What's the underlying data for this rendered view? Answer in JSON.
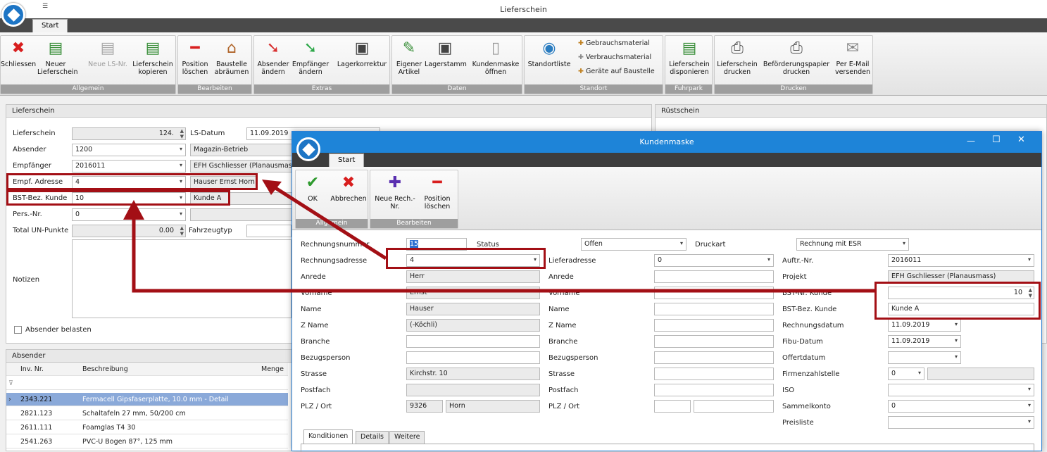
{
  "app": {
    "title": "Lieferschein",
    "qat": "☰",
    "tab": "Start"
  },
  "ribbon": {
    "groups": [
      "Allgemein",
      "Bearbeiten",
      "Extras",
      "Daten",
      "Standort",
      "Fuhrpark",
      "Drucken"
    ],
    "buttons": [
      {
        "l1": "Schliessen",
        "l2": "",
        "icon": "✖",
        "color": "#d81e1e"
      },
      {
        "l1": "Neuer",
        "l2": "Lieferschein",
        "icon": "☰",
        "color": "#3a8f3a"
      },
      {
        "l1": "Neue LS-Nr.",
        "l2": "",
        "icon": "☰",
        "color": "#aaaaaa"
      },
      {
        "l1": "Lieferschein",
        "l2": "kopieren",
        "icon": "☰",
        "color": "#3a8f3a"
      },
      {
        "l1": "Position",
        "l2": "löschen",
        "icon": "━",
        "color": "#d81e1e"
      },
      {
        "l1": "Baustelle",
        "l2": "abräumen",
        "icon": "⌂",
        "color": "#b0652a"
      },
      {
        "l1": "Absender",
        "l2": "ändern",
        "icon": "↘",
        "color": "#d83030"
      },
      {
        "l1": "Empfänger",
        "l2": "ändern",
        "icon": "↘",
        "color": "#2ea84a"
      },
      {
        "l1": "Lagerkorrektur",
        "l2": "",
        "icon": "▣",
        "color": "#444444"
      },
      {
        "l1": "Eigener",
        "l2": "Artikel",
        "icon": "✎",
        "color": "#3a8f3a"
      },
      {
        "l1": "Lagerstamm",
        "l2": "",
        "icon": "▣",
        "color": "#444444"
      },
      {
        "l1": "Kundenmaske",
        "l2": "öffnen",
        "icon": "▯",
        "color": "#999999"
      },
      {
        "l1": "Standortliste",
        "l2": "",
        "icon": "◉",
        "color": "#2a7cc0"
      },
      {
        "l1": "Lieferschein",
        "l2": "disponieren",
        "icon": "☰",
        "color": "#3a8f3a"
      },
      {
        "l1": "Lieferschein",
        "l2": "drucken",
        "icon": "⎙",
        "color": "#555555"
      },
      {
        "l1": "Beförderungspapier",
        "l2": "drucken",
        "icon": "⎙",
        "color": "#555555"
      },
      {
        "l1": "Per E-Mail",
        "l2": "versenden",
        "icon": "✉",
        "color": "#777777"
      }
    ],
    "small": [
      "Gebrauchsmaterial",
      "Verbrauchsmaterial",
      "Geräte auf Baustelle"
    ]
  },
  "main": {
    "panel_title": "Lieferschein",
    "ruest_title": "Rüstschein",
    "labels": [
      "Lieferschein",
      "Absender",
      "Empfänger",
      "Empf. Adresse",
      "BST-Bez. Kunde",
      "Pers.-Nr.",
      "Total UN-Punkte",
      "Notizen"
    ],
    "ls_nr": "124.",
    "absender": "1200",
    "empfaenger": "2016011",
    "empf_adresse": "4",
    "bst_bez": "10",
    "pers_nr": "0",
    "total": "0.00",
    "ls_datum_label": "LS-Datum",
    "ls_datum": "11.09.2019",
    "absender_name": "Magazin-Betrieb",
    "empf_name": "EFH Gschliesser (Planausmass)",
    "adr_name": "Hauser Ernst Horn",
    "kunde": "Kunde A",
    "fahrzeug_label": "Fahrzeugtyp",
    "absender_belasten": "Absender belasten"
  },
  "grid": {
    "title": "Absender",
    "headers": [
      "Inv. Nr.",
      "Beschreibung",
      "Menge"
    ],
    "rows": [
      {
        "inv": "2343.221",
        "desc": "Fermacell Gipsfaserplatte, 10.0 mm - Detail"
      },
      {
        "inv": "2821.123",
        "desc": "Schaltafeln 27 mm, 50/200 cm"
      },
      {
        "inv": "2611.111",
        "desc": "Foamglas T4  30"
      },
      {
        "inv": "2541.263",
        "desc": "PVC-U Bogen 87°, 125 mm"
      }
    ]
  },
  "dialog": {
    "title": "Kundenmaske",
    "tab": "Start",
    "buttons": [
      "OK",
      "Abbrechen",
      "Neue Rech.-Nr.",
      "Position",
      "löschen"
    ],
    "groups": [
      "Allgemein",
      "Bearbeiten"
    ],
    "col1": {
      "labels": [
        "Rechnungsnummer",
        "Rechnungsadresse",
        "Anrede",
        "Vorname",
        "Name",
        "Z Name",
        "Branche",
        "Bezugsperson",
        "Strasse",
        "Postfach",
        "PLZ / Ort"
      ],
      "values": [
        "15",
        "4",
        "Herr",
        "Ernst",
        "Hauser",
        "(-Köchli)",
        "",
        "",
        "Kirchstr. 10",
        "",
        "9326"
      ],
      "ort": "Horn"
    },
    "status_label": "Status",
    "status": "Offen",
    "druckart_label": "Druckart",
    "druckart": "Rechnung mit ESR",
    "col2": {
      "labels": [
        "Lieferadresse",
        "Anrede",
        "Vorname",
        "Name",
        "Z Name",
        "Branche",
        "Bezugsperson",
        "Strasse",
        "Postfach",
        "PLZ / Ort"
      ],
      "lieferadresse": "0"
    },
    "col3": {
      "labels": [
        "Auftr.-Nr.",
        "Projekt",
        "BST-Nr. Kunde",
        "BST-Bez. Kunde",
        "Rechnungsdatum",
        "Fibu-Datum",
        "Offertdatum",
        "Firmenzahlstelle",
        "ISO",
        "Sammelkonto",
        "Preisliste"
      ],
      "values": [
        "2016011",
        "EFH Gschliesser (Planausmass)",
        "10",
        "Kunde A",
        "11.09.2019",
        "11.09.2019",
        "",
        "0",
        "",
        "0",
        ""
      ]
    },
    "tabs": [
      "Konditionen",
      "Details",
      "Weitere"
    ]
  }
}
